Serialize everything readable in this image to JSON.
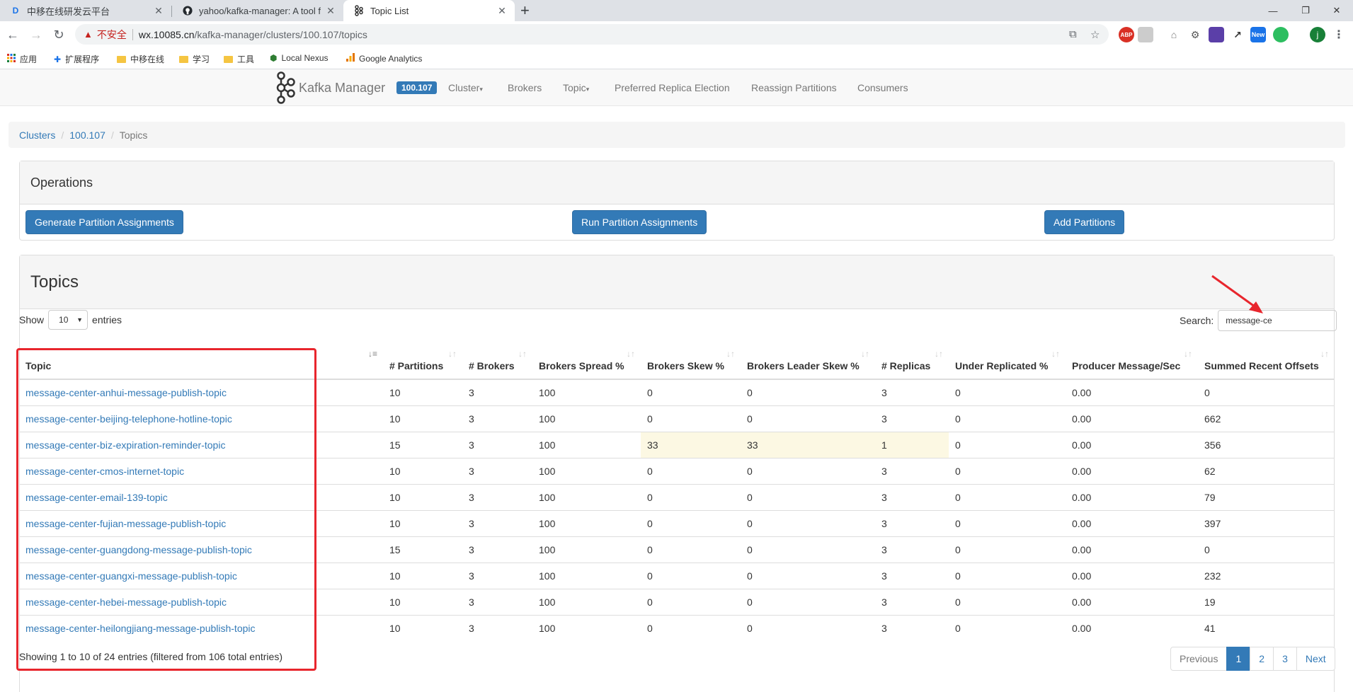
{
  "browser": {
    "tabs": [
      {
        "title": "中移在线研发云平台",
        "icon": "devcloud-icon"
      },
      {
        "title": "yahoo/kafka-manager: A tool f",
        "icon": "github-icon"
      },
      {
        "title": "Topic List",
        "icon": "kafka-icon"
      }
    ],
    "address": {
      "security_label": "不安全",
      "host": "wx.10085.cn",
      "path": "/kafka-manager/clusters/100.107/topics"
    },
    "extensions": {
      "abp": "ABP",
      "new": "New",
      "profile": "j"
    },
    "bookmarks": [
      {
        "label": "应用",
        "icon": "apps-icon"
      },
      {
        "label": "扩展程序",
        "icon": "puzzle-icon"
      },
      {
        "label": "中移在线",
        "icon": "folder-icon"
      },
      {
        "label": "学习",
        "icon": "folder-icon"
      },
      {
        "label": "工具",
        "icon": "folder-icon"
      },
      {
        "label": "Local Nexus",
        "icon": "nexus-icon"
      },
      {
        "label": "Google Analytics",
        "icon": "analytics-icon"
      }
    ]
  },
  "navbar": {
    "brand": "Kafka Manager",
    "cluster_badge": "100.107",
    "links": {
      "cluster": "Cluster",
      "brokers": "Brokers",
      "topic": "Topic",
      "preferred": "Preferred Replica Election",
      "reassign": "Reassign Partitions",
      "consumers": "Consumers"
    }
  },
  "breadcrumb": {
    "clusters": "Clusters",
    "cluster": "100.107",
    "current": "Topics"
  },
  "operations": {
    "title": "Operations",
    "generate": "Generate Partition Assignments",
    "run": "Run Partition Assignments",
    "add": "Add Partitions"
  },
  "topics_panel": {
    "title": "Topics",
    "show_label": "Show",
    "entries_value": "10",
    "entries_label": "entries",
    "search_label": "Search:",
    "search_value": "message-ce",
    "columns": [
      "Topic",
      "# Partitions",
      "# Brokers",
      "Brokers Spread %",
      "Brokers Skew %",
      "Brokers Leader Skew %",
      "# Replicas",
      "Under Replicated %",
      "Producer Message/Sec",
      "Summed Recent Offsets"
    ],
    "rows": [
      [
        "message-center-anhui-message-publish-topic",
        "10",
        "3",
        "100",
        "0",
        "0",
        "3",
        "0",
        "0.00",
        "0"
      ],
      [
        "message-center-beijing-telephone-hotline-topic",
        "10",
        "3",
        "100",
        "0",
        "0",
        "3",
        "0",
        "0.00",
        "662"
      ],
      [
        "message-center-biz-expiration-reminder-topic",
        "15",
        "3",
        "100",
        "33",
        "33",
        "1",
        "0",
        "0.00",
        "356"
      ],
      [
        "message-center-cmos-internet-topic",
        "10",
        "3",
        "100",
        "0",
        "0",
        "3",
        "0",
        "0.00",
        "62"
      ],
      [
        "message-center-email-139-topic",
        "10",
        "3",
        "100",
        "0",
        "0",
        "3",
        "0",
        "0.00",
        "79"
      ],
      [
        "message-center-fujian-message-publish-topic",
        "10",
        "3",
        "100",
        "0",
        "0",
        "3",
        "0",
        "0.00",
        "397"
      ],
      [
        "message-center-guangdong-message-publish-topic",
        "15",
        "3",
        "100",
        "0",
        "0",
        "3",
        "0",
        "0.00",
        "0"
      ],
      [
        "message-center-guangxi-message-publish-topic",
        "10",
        "3",
        "100",
        "0",
        "0",
        "3",
        "0",
        "0.00",
        "232"
      ],
      [
        "message-center-hebei-message-publish-topic",
        "10",
        "3",
        "100",
        "0",
        "0",
        "3",
        "0",
        "0.00",
        "19"
      ],
      [
        "message-center-heilongjiang-message-publish-topic",
        "10",
        "3",
        "100",
        "0",
        "0",
        "3",
        "0",
        "0.00",
        "41"
      ]
    ],
    "info": "Showing 1 to 10 of 24 entries (filtered from 106 total entries)",
    "pagination": {
      "previous": "Previous",
      "pages": [
        "1",
        "2",
        "3"
      ],
      "next": "Next"
    }
  },
  "colors": {
    "primary": "#337ab7",
    "warning_row": "#fcf8e3",
    "annotation": "#e8262d"
  }
}
